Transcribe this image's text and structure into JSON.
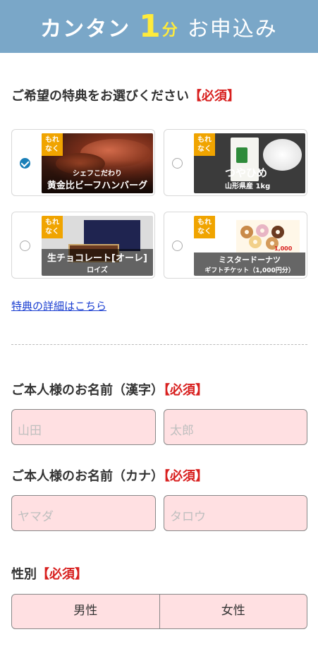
{
  "header": {
    "prefix": "カンタン",
    "number": "1",
    "unit": "分",
    "suffix": "お申込み"
  },
  "benefit": {
    "label": "ご希望の特典をお選びください",
    "required": "【必須】",
    "tag_line1": "もれ",
    "tag_line2": "なく",
    "options": [
      {
        "caption_top": "シェフこだわり",
        "caption_main": "黄金比ビーフハンバーグ",
        "checked": true
      },
      {
        "caption_main": "つやひめ",
        "caption_sub": "山形県産 1kg",
        "checked": false
      },
      {
        "caption_main": "生チョコレート[オーレ]",
        "caption_sub": "ロイズ",
        "checked": false
      },
      {
        "caption_main": "ミスタードーナツ",
        "caption_sub": "ギフトチケット（1,000円分）",
        "price_tag": "1,000",
        "checked": false
      }
    ],
    "detail_link": "特典の詳細はこちら"
  },
  "name_kanji": {
    "label": "ご本人様のお名前（漢字）",
    "required": "【必須】",
    "last_placeholder": "山田",
    "first_placeholder": "太郎"
  },
  "name_kana": {
    "label": "ご本人様のお名前（カナ）",
    "required": "【必須】",
    "last_placeholder": "ヤマダ",
    "first_placeholder": "タロウ"
  },
  "gender": {
    "label": "性別",
    "required": "【必須】",
    "male": "男性",
    "female": "女性"
  },
  "colors": {
    "header": "#7aa7c8",
    "accent": "#f0a400",
    "required": "#d8201f",
    "input_bg": "#ffe0e2",
    "link": "#1a3ed1",
    "radio_checked": "#1a7fb8"
  }
}
